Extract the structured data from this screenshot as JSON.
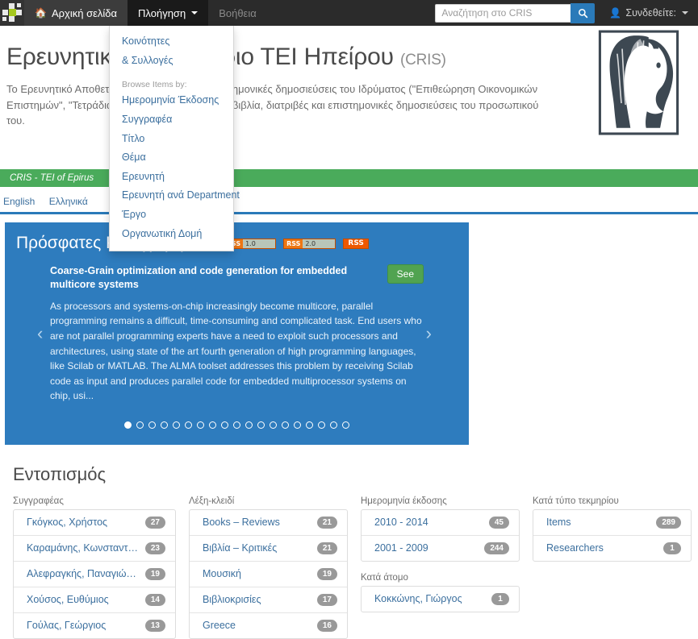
{
  "navbar": {
    "grid_icon": "grid-icon",
    "items": [
      {
        "label": "Αρχική σελίδα",
        "icon": "home-icon",
        "state": "home"
      },
      {
        "label": "Πλοήγηση",
        "icon": "chevron-down-icon",
        "state": "active"
      },
      {
        "label": "Βοήθεια",
        "icon": "",
        "state": "muted"
      }
    ],
    "search": {
      "placeholder": "Αναζήτηση στο CRIS",
      "value": "",
      "button_icon": "search-icon"
    },
    "user": {
      "label": "Συνδεθείτε:",
      "icon": "user-icon"
    }
  },
  "dropdown": {
    "top_items": [
      "Κοινότητες",
      "& Συλλογές"
    ],
    "section_header": "Browse Items by:",
    "items": [
      "Ημερομηνία Έκδοσης",
      "Συγγραφέα",
      "Τίτλο",
      "Θέμα",
      "Ερευνητή",
      "Ερευνητή ανά Department",
      "Έργο",
      "Οργανωτική Δομή"
    ]
  },
  "hero": {
    "title_prefix": "Ερευνητικό Αποθετήριο",
    "title_mid": "ΤΕΙ Ηπείρου",
    "title_suffix": "(CRIS)",
    "description": "Το Ερευνητικό Αποθετήριο (CRIS) περιέχει επιστημονικές δημοσιεύσεις του Ιδρύματος (\"Επιθεώρηση Οικονομικών Επιστημών\", \"Τετράδια\", Εισηγήσεις), καθώς και βιβλία, διατριβές και επιστημονικές δημοσιεύσεις του προσωπικού του.",
    "logo_icon": "tei-epirus-bust-logo"
  },
  "greenbar": {
    "label": "CRIS - TEI of Epirus"
  },
  "langbar": {
    "links": [
      "English",
      "Ελληνικά"
    ]
  },
  "slider": {
    "title": "Πρόσφατες Καταχωρήσεις",
    "rss": [
      {
        "label": "RSS",
        "version": "1.0"
      },
      {
        "label": "RSS",
        "version": "2.0"
      }
    ],
    "rss_solid": "RSS",
    "slide": {
      "title": "Coarse-Grain optimization and code generation for embedded multicore systems",
      "button": "See",
      "text": "As processors and systems-on-chip increasingly become multicore, parallel programming remains a difficult, time-consuming and complicated task. End users who are not parallel programming experts have a need to exploit such processors and architectures, using state of the art fourth generation of high programming languages, like Scilab or MATLAB. The ALMA toolset addresses this problem by receiving Scilab code as input and produces parallel code for embedded multiprocessor systems on chip, usi..."
    },
    "arrow_left": "‹",
    "arrow_right": "›",
    "dot_count": 19,
    "active_dot": 0
  },
  "discovery": {
    "title": "Εντοπισμός",
    "columns": [
      {
        "label": "Συγγραφέας",
        "groups": [
          {
            "items": [
              {
                "name": "Γκόγκος, Χρήστος",
                "count": "27"
              },
              {
                "name": "Καραμάνης, Κωνσταντίνος",
                "count": "23"
              },
              {
                "name": "Αλεφραγκής, Παναγιώτης",
                "count": "19"
              },
              {
                "name": "Χούσος, Ευθύμιος",
                "count": "14"
              },
              {
                "name": "Γούλας, Γεώργιος",
                "count": "13"
              }
            ]
          }
        ]
      },
      {
        "label": "Λέξη-κλειδί",
        "groups": [
          {
            "items": [
              {
                "name": "Books – Reviews",
                "count": "21"
              },
              {
                "name": "Βιβλία – Κριτικές",
                "count": "21"
              },
              {
                "name": "Μουσική",
                "count": "19"
              },
              {
                "name": "Βιβλιοκρισίες",
                "count": "17"
              },
              {
                "name": "Greece",
                "count": "16"
              }
            ]
          }
        ]
      },
      {
        "label": "Ημερομηνία έκδοσης",
        "groups": [
          {
            "items": [
              {
                "name": "2010 - 2014",
                "count": "45"
              },
              {
                "name": "2001 - 2009",
                "count": "244"
              }
            ]
          },
          {
            "label": "Κατά άτομο",
            "items": [
              {
                "name": "Κοκκώνης, Γιώργος",
                "count": "1"
              }
            ]
          }
        ]
      },
      {
        "label": "Κατά τύπο τεκμηρίου",
        "groups": [
          {
            "items": [
              {
                "name": "Items",
                "count": "289"
              },
              {
                "name": "Researchers",
                "count": "1"
              }
            ]
          }
        ]
      }
    ]
  },
  "colors": {
    "nav_bg": "#2b2b2b",
    "accent_blue": "#2a7ab9",
    "slider_blue": "#2e7cbe",
    "green_bar": "#4aab5b",
    "link_blue": "#3b6f9e",
    "badge_gray": "#999999",
    "rss_orange": "#ee5800",
    "see_green": "#51a351"
  }
}
